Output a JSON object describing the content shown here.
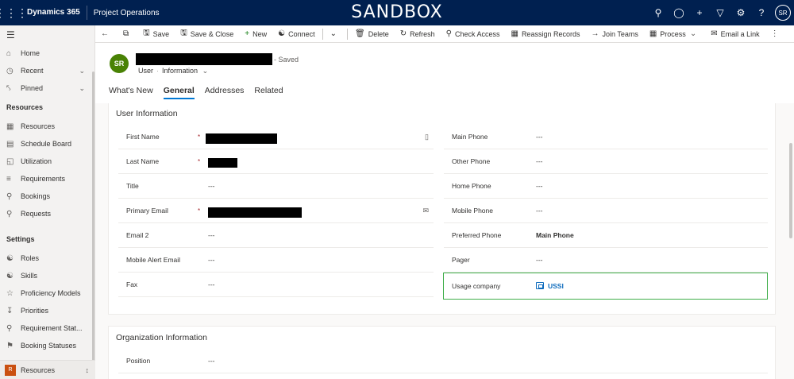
{
  "topbar": {
    "brand": "Dynamics 365",
    "app_name": "Project Operations",
    "environment_banner": "SANDBOX",
    "user_initials": "SR",
    "icons": [
      "search-icon",
      "lightbulb-icon",
      "plus-icon",
      "filter-icon",
      "gear-icon",
      "help-icon"
    ]
  },
  "sidebar": {
    "top_items": [
      {
        "label": "Home",
        "icon": "home-icon"
      },
      {
        "label": "Recent",
        "icon": "clock-icon"
      },
      {
        "label": "Pinned",
        "icon": "pin-icon"
      }
    ],
    "resources_header": "Resources",
    "resources_items": [
      {
        "label": "Resources",
        "icon": "resources-icon"
      },
      {
        "label": "Schedule Board",
        "icon": "calendar-icon"
      },
      {
        "label": "Utilization",
        "icon": "utilization-icon"
      },
      {
        "label": "Requirements",
        "icon": "list-icon"
      },
      {
        "label": "Bookings",
        "icon": "bookings-icon"
      },
      {
        "label": "Requests",
        "icon": "requests-icon"
      }
    ],
    "settings_header": "Settings",
    "settings_items": [
      {
        "label": "Roles",
        "icon": "roles-icon"
      },
      {
        "label": "Skills",
        "icon": "skills-icon"
      },
      {
        "label": "Proficiency Models",
        "icon": "star-icon"
      },
      {
        "label": "Priorities",
        "icon": "sort-icon"
      },
      {
        "label": "Requirement Stat...",
        "icon": "status-icon"
      },
      {
        "label": "Booking Statuses",
        "icon": "flag-icon"
      }
    ],
    "area": {
      "badge": "R",
      "label": "Resources"
    }
  },
  "commandbar": {
    "save": "Save",
    "save_close": "Save & Close",
    "new": "New",
    "connect": "Connect",
    "delete": "Delete",
    "refresh": "Refresh",
    "check_access": "Check Access",
    "reassign": "Reassign Records",
    "join_teams": "Join Teams",
    "process": "Process",
    "email_link": "Email a Link"
  },
  "header": {
    "avatar": "SR",
    "saved_status": "- Saved",
    "entity": "User",
    "form": "Information",
    "tabs": [
      "What's New",
      "General",
      "Addresses",
      "Related"
    ],
    "active_tab": "General"
  },
  "user_info": {
    "title": "User Information",
    "left_fields": [
      {
        "label": "First Name",
        "value": ""
      },
      {
        "label": "Last Name",
        "value": ""
      },
      {
        "label": "Title",
        "value": "---"
      },
      {
        "label": "Primary Email",
        "value": ""
      },
      {
        "label": "Email 2",
        "value": "---"
      },
      {
        "label": "Mobile Alert Email",
        "value": "---"
      },
      {
        "label": "Fax",
        "value": "---"
      }
    ],
    "right_fields": [
      {
        "label": "Main Phone",
        "value": "---"
      },
      {
        "label": "Other Phone",
        "value": "---"
      },
      {
        "label": "Home Phone",
        "value": "---"
      },
      {
        "label": "Mobile Phone",
        "value": "---"
      },
      {
        "label": "Preferred Phone",
        "value": "Main Phone"
      },
      {
        "label": "Pager",
        "value": "---"
      },
      {
        "label": "Usage company",
        "value": "USSI"
      }
    ]
  },
  "org_info": {
    "title": "Organization Information",
    "fields": [
      {
        "label": "Position",
        "value": "---"
      }
    ]
  },
  "colors": {
    "topbar": "#002050",
    "avatar": "#498205",
    "highlight": "#3fae49",
    "link": "#0f6cbd",
    "area_badge": "#ca5010"
  }
}
